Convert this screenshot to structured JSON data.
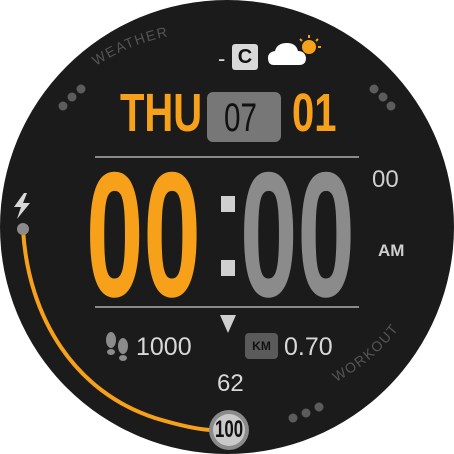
{
  "weather": {
    "label": "WEATHER",
    "temperature_dash": "-",
    "temperature_unit": "C",
    "icon": "partly-sunny-icon"
  },
  "date": {
    "day": "THU",
    "month": "07",
    "date": "01"
  },
  "time": {
    "hour": "00",
    "minute": "00",
    "second": "00",
    "ampm": "AM"
  },
  "stats": {
    "steps": "1000",
    "distance_unit": "KM",
    "distance": "0.70",
    "heart_rate": "62",
    "battery": "100",
    "battery_level": 1.0
  },
  "complications": {
    "workout_label": "WORKOUT",
    "charge_icon": "lightning-icon",
    "steps_icon": "footsteps-icon"
  },
  "colors": {
    "background": "#ffffff",
    "face": "#1b1b1b",
    "accent": "#f7a11a",
    "secondary": "#8b8b8b",
    "text_light": "#d8d8d8"
  }
}
